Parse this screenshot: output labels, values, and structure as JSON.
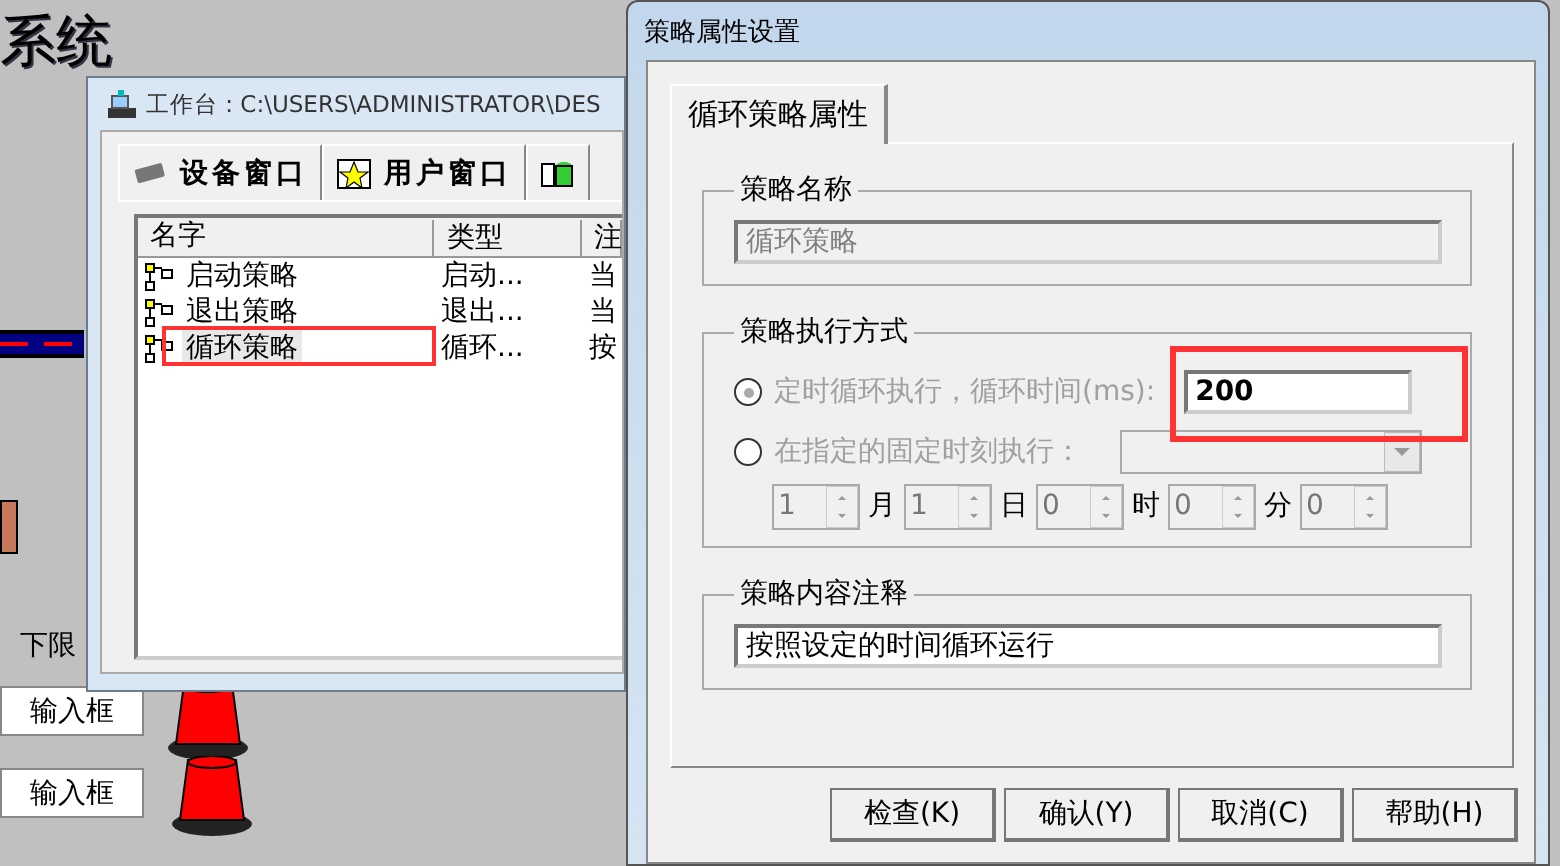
{
  "canvas": {
    "title_fragment": "系统",
    "labels": [
      "下限"
    ],
    "input_boxes": [
      "输入框",
      "输入框"
    ]
  },
  "workbench": {
    "title": "工作台 : C:\\USERS\\ADMINISTRATOR\\DES",
    "tabs": [
      {
        "label": "设备窗口"
      },
      {
        "label": "用户窗口"
      }
    ],
    "columns": [
      "名字",
      "类型",
      "注"
    ],
    "rows": [
      {
        "cells": [
          "启动策略",
          "启动...",
          "当"
        ],
        "selected": false
      },
      {
        "cells": [
          "退出策略",
          "退出...",
          "当"
        ],
        "selected": false
      },
      {
        "cells": [
          "循环策略",
          "循环...",
          "按"
        ],
        "selected": true
      }
    ]
  },
  "dialog": {
    "title": "策略属性设置",
    "tab": "循环策略属性",
    "name_group": {
      "title": "策略名称",
      "value": "循环策略",
      "disabled": true
    },
    "exec_group": {
      "title": "策略执行方式",
      "options": [
        {
          "label": "定时循环执行，循环时间(ms):",
          "selected": true,
          "disabled": true
        },
        {
          "label": "在指定的固定时刻执行：",
          "selected": false,
          "disabled": true
        }
      ],
      "interval": "200",
      "spinners": [
        {
          "value": "1",
          "unit": "月"
        },
        {
          "value": "1",
          "unit": "日"
        },
        {
          "value": "0",
          "unit": "时"
        },
        {
          "value": "0",
          "unit": "分"
        },
        {
          "value": "0"
        }
      ]
    },
    "comment_group": {
      "title": "策略内容注释",
      "value": "按照设定的时间循环运行",
      "disabled": false
    },
    "buttons": [
      "检查(K)",
      "确认(Y)",
      "取消(C)",
      "帮助(H)"
    ]
  }
}
